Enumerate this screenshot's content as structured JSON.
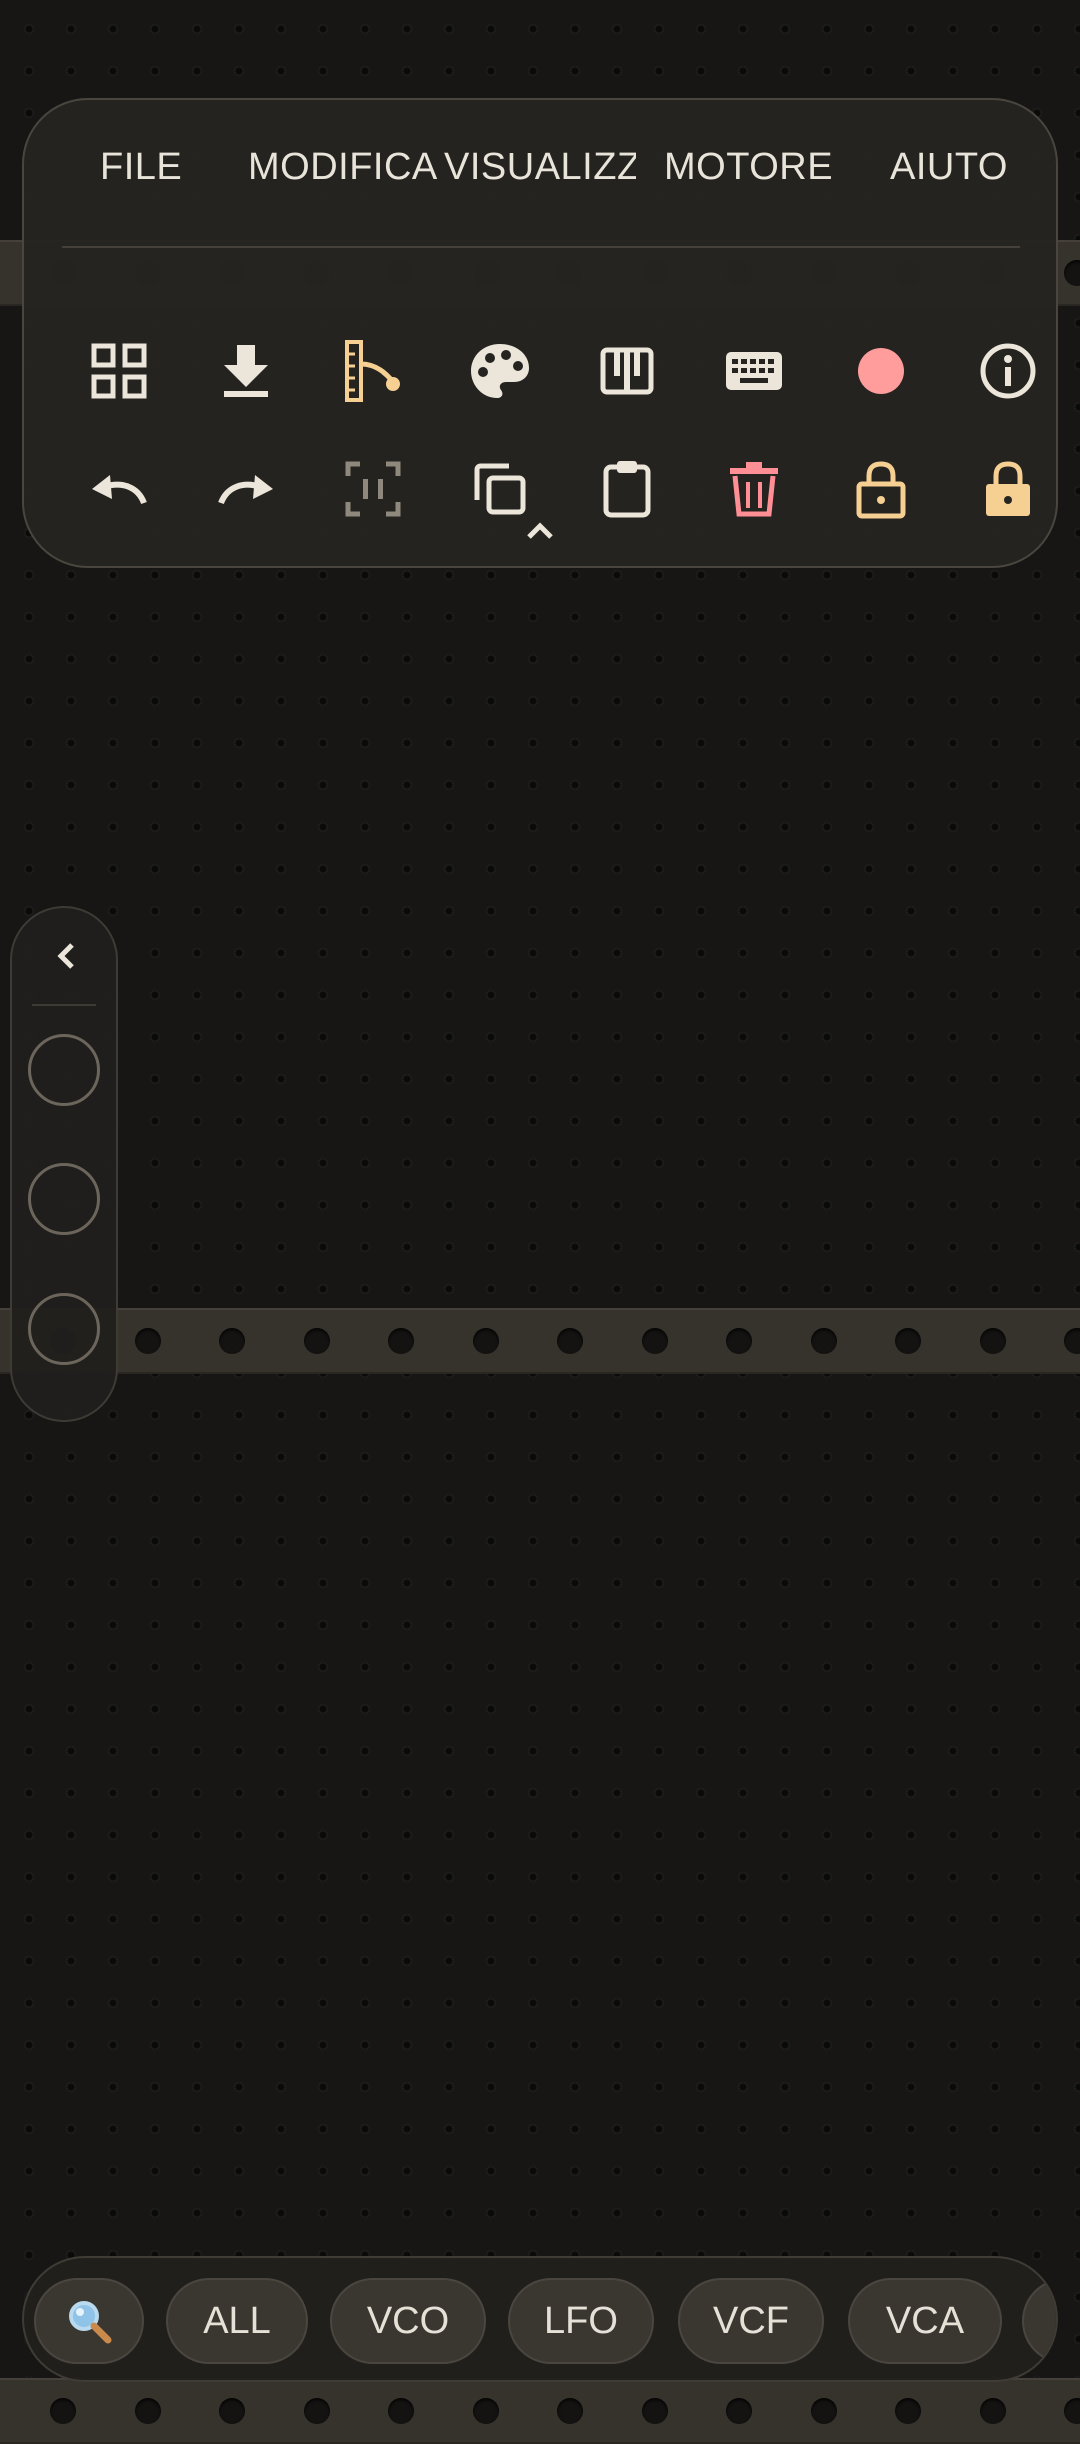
{
  "menu": {
    "items": [
      "FILE",
      "MODIFICA",
      "VISUALIZZA",
      "MOTORE",
      "AIUTO"
    ]
  },
  "toolbar": {
    "row1": [
      {
        "icon": "module-browser-icon",
        "color": "#ece6da"
      },
      {
        "icon": "download-icon",
        "color": "#ece6da"
      },
      {
        "icon": "cable-routing-icon",
        "color": "#f6cf92"
      },
      {
        "icon": "palette-icon",
        "color": "#ece6da"
      },
      {
        "icon": "piano-keys-icon",
        "color": "#ece6da"
      },
      {
        "icon": "keyboard-icon",
        "color": "#ece6da"
      },
      {
        "icon": "record-icon",
        "color": "#ff9c9c"
      },
      {
        "icon": "info-icon",
        "color": "#ece6da"
      }
    ],
    "row2": [
      {
        "icon": "undo-icon",
        "color": "#ece6da"
      },
      {
        "icon": "redo-icon",
        "color": "#ece6da"
      },
      {
        "icon": "select-frame-icon",
        "color": "#8f887c"
      },
      {
        "icon": "copy-icon",
        "color": "#ece6da"
      },
      {
        "icon": "paste-icon",
        "color": "#ece6da"
      },
      {
        "icon": "trash-icon",
        "color": "#ff8e95"
      },
      {
        "icon": "lock-open-icon",
        "color": "#f6cf92"
      },
      {
        "icon": "lock-closed-icon",
        "color": "#f6cf92"
      }
    ],
    "collapse_icon": "chevron-up-icon"
  },
  "side_panel": {
    "back_icon": "chevron-left-icon",
    "slots": 3
  },
  "filter_bar": {
    "search_icon": "magnifier-icon",
    "chips": [
      "ALL",
      "VCO",
      "LFO",
      "VCF",
      "VCA"
    ]
  },
  "colors": {
    "background": "#171615",
    "rail": "#36322c",
    "panel": "#262421",
    "text": "#e9e4da",
    "accent": "#f6cf92",
    "danger": "#ff8e95"
  }
}
